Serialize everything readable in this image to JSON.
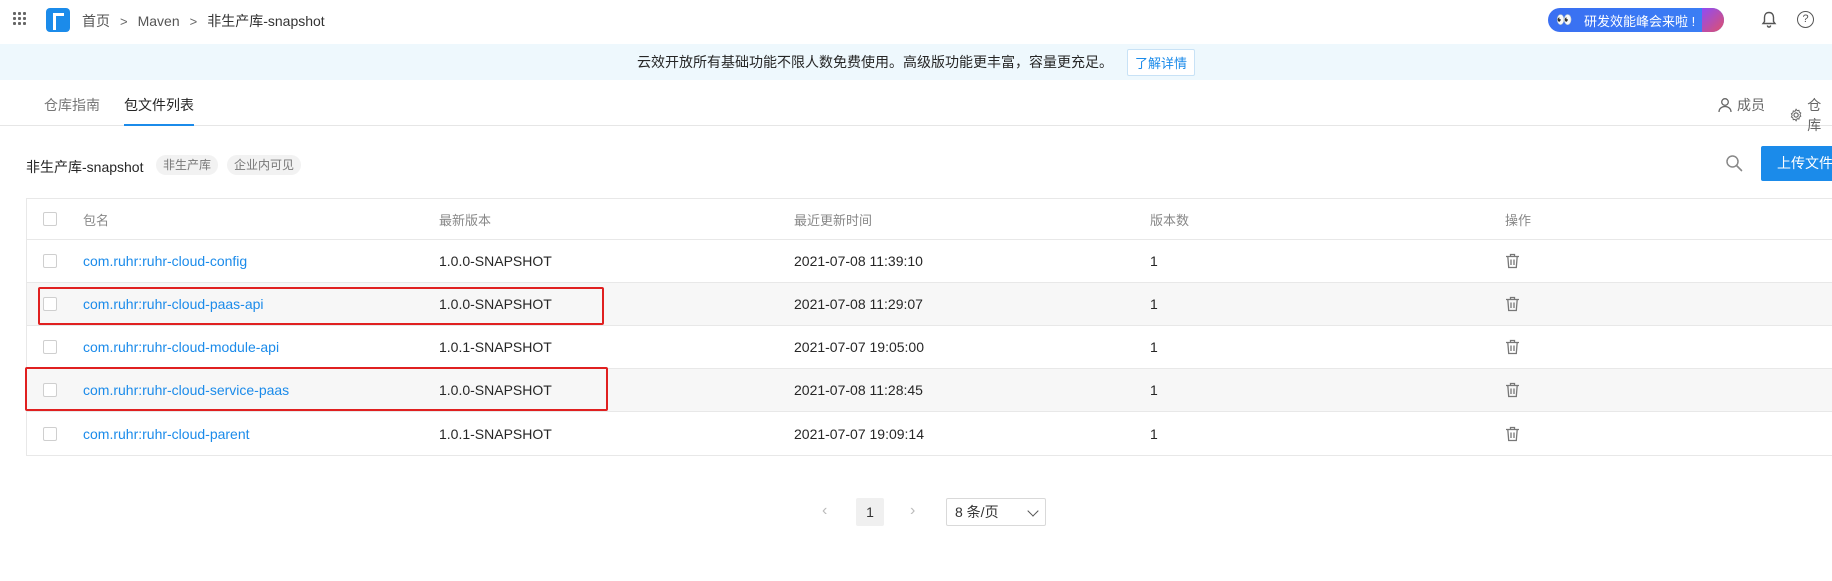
{
  "breadcrumb": {
    "home": "首页",
    "group": "Maven",
    "current": "非生产库-snapshot"
  },
  "promo": {
    "eyes": "👀",
    "text": "研发效能峰会来啦 !"
  },
  "banner": {
    "text": "云效开放所有基础功能不限人数免费使用。高级版功能更丰富，容量更充足。",
    "link": "了解详情"
  },
  "tabs": [
    {
      "label": "仓库指南"
    },
    {
      "label": "包文件列表"
    }
  ],
  "right_links": {
    "members": "成员",
    "settings": "仓库"
  },
  "repo": {
    "name": "非生产库-snapshot",
    "tags": [
      "非生产库",
      "企业内可见"
    ],
    "upload_label": "上传文件"
  },
  "table": {
    "headers": [
      "包名",
      "最新版本",
      "最近更新时间",
      "版本数",
      "操作"
    ],
    "rows": [
      {
        "name": "com.ruhr:ruhr-cloud-config",
        "version": "1.0.0-SNAPSHOT",
        "updated": "2021-07-08 11:39:10",
        "count": "1"
      },
      {
        "name": "com.ruhr:ruhr-cloud-paas-api",
        "version": "1.0.0-SNAPSHOT",
        "updated": "2021-07-08 11:29:07",
        "count": "1"
      },
      {
        "name": "com.ruhr:ruhr-cloud-module-api",
        "version": "1.0.1-SNAPSHOT",
        "updated": "2021-07-07 19:05:00",
        "count": "1"
      },
      {
        "name": "com.ruhr:ruhr-cloud-service-paas",
        "version": "1.0.0-SNAPSHOT",
        "updated": "2021-07-08 11:28:45",
        "count": "1"
      },
      {
        "name": "com.ruhr:ruhr-cloud-parent",
        "version": "1.0.1-SNAPSHOT",
        "updated": "2021-07-07 19:09:14",
        "count": "1"
      }
    ]
  },
  "pagination": {
    "prev": "‹",
    "current": "1",
    "next": "›",
    "page_size": "8 条/页"
  },
  "colors": {
    "accent": "#1b8bea",
    "highlight": "#e02020",
    "banner_bg": "#eef8fd"
  }
}
